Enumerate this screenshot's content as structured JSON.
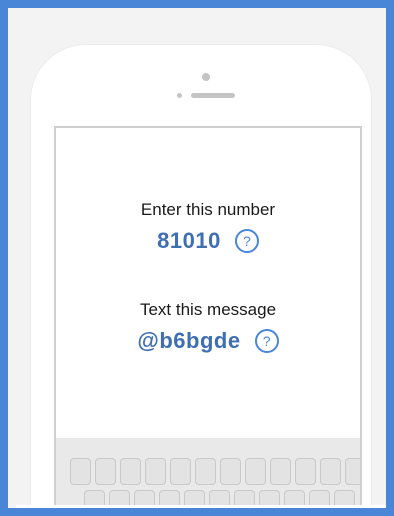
{
  "instructions": {
    "number_label": "Enter this number",
    "number_value": "81010",
    "message_label": "Text this message",
    "message_value": "@b6bgde",
    "help_symbol": "?"
  },
  "icons": {
    "help": "question-circle-icon"
  },
  "colors": {
    "frame_border": "#4a86d8",
    "accent_text": "#3f6fb0",
    "help_icon": "#4a86d8"
  }
}
